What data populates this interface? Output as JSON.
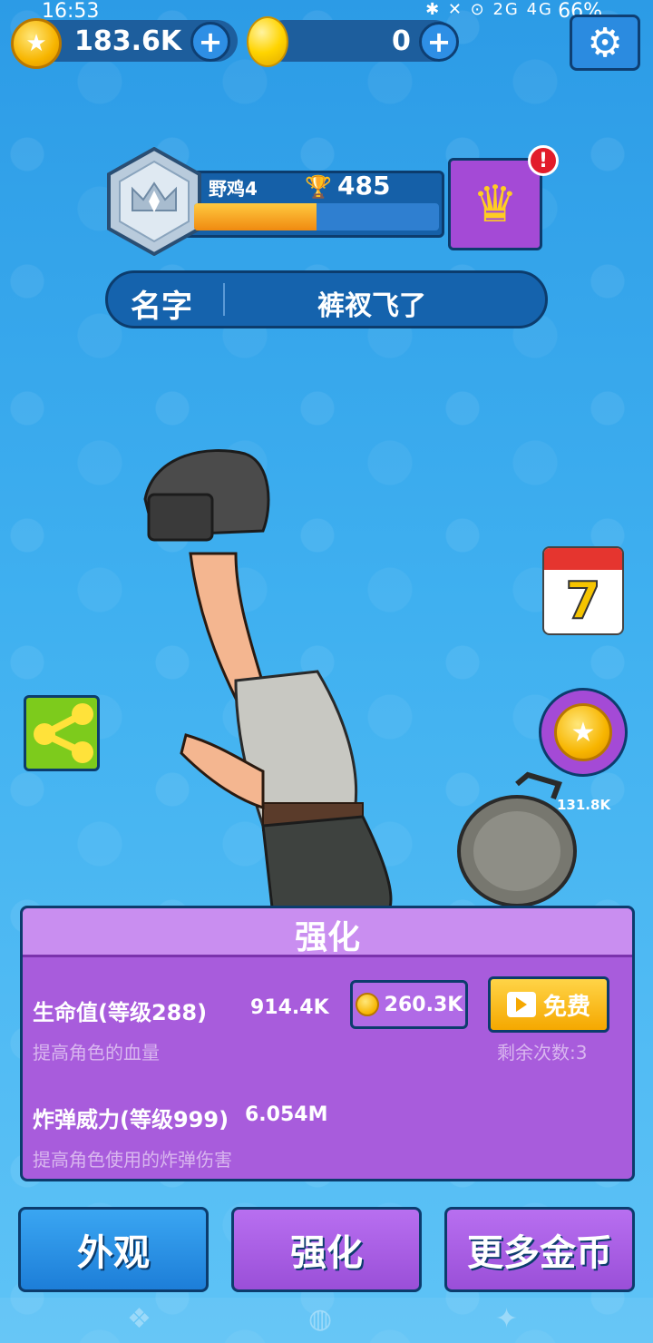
{
  "status_bar": {
    "time": "16:53",
    "indicators": "✱ ✕ ⊙ 2G 4G",
    "battery": "66%"
  },
  "currency": {
    "coins": "183.6K",
    "gems": "0",
    "plus_symbol": "+"
  },
  "settings": {
    "icon": "gear-icon"
  },
  "rank": {
    "name": "野鸡4",
    "trophies": "485",
    "progress_fraction": 0.5
  },
  "crown_button": {
    "alert_symbol": "!"
  },
  "profile": {
    "label": "名字",
    "name": "裤衩飞了"
  },
  "side": {
    "calendar_day": "7",
    "coin_bubble_value": "131.8K"
  },
  "upgrade_panel": {
    "title": "强化",
    "health": {
      "label": "生命值(等级288)",
      "value": "914.4K",
      "desc": "提高角色的血量",
      "cost": "260.3K",
      "free_label": "免费",
      "remaining": "剩余次数:3"
    },
    "bomb": {
      "label": "炸弹威力(等级999)",
      "value": "6.054M",
      "desc": "提高角色使用的炸弹伤害"
    }
  },
  "bottom_buttons": {
    "appearance": "外观",
    "upgrade": "强化",
    "more_coins": "更多金币"
  },
  "colors": {
    "panel_purple": "#a85cdc",
    "button_blue": "#1d7ed8",
    "outline": "#0c3c6d",
    "coin_gold": "#f7b500"
  }
}
